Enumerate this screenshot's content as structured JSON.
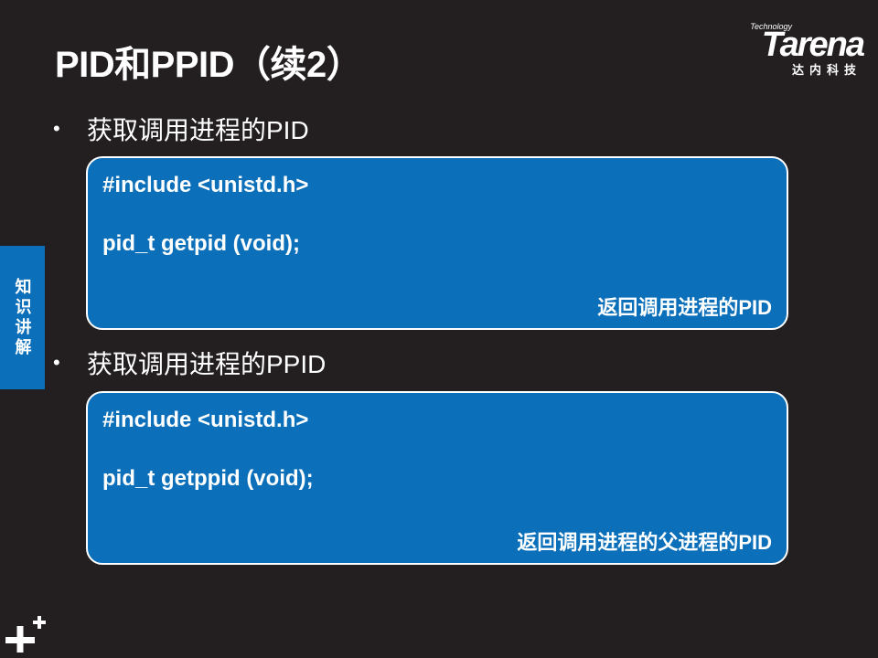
{
  "title": "PID和PPID（续2）",
  "logo": {
    "wordmark": "Tarena",
    "tagline": "Technology",
    "subtitle": "达内科技"
  },
  "side_tab": {
    "label": "知识讲解"
  },
  "sections": [
    {
      "bullet": "获取调用进程的PID",
      "code": {
        "line1": "#include <unistd.h>",
        "line2": "pid_t getpid (void);",
        "note": "返回调用进程的PID"
      }
    },
    {
      "bullet": "获取调用进程的PPID",
      "code": {
        "line1": "#include <unistd.h>",
        "line2": "pid_t getppid (void);",
        "note": "返回调用进程的父进程的PID"
      }
    }
  ],
  "colors": {
    "background": "#231f20",
    "accent": "#0b6fba",
    "text": "#ffffff"
  },
  "icons": {
    "bullet": "bullet-dot-icon",
    "footer": "plus-icon"
  }
}
